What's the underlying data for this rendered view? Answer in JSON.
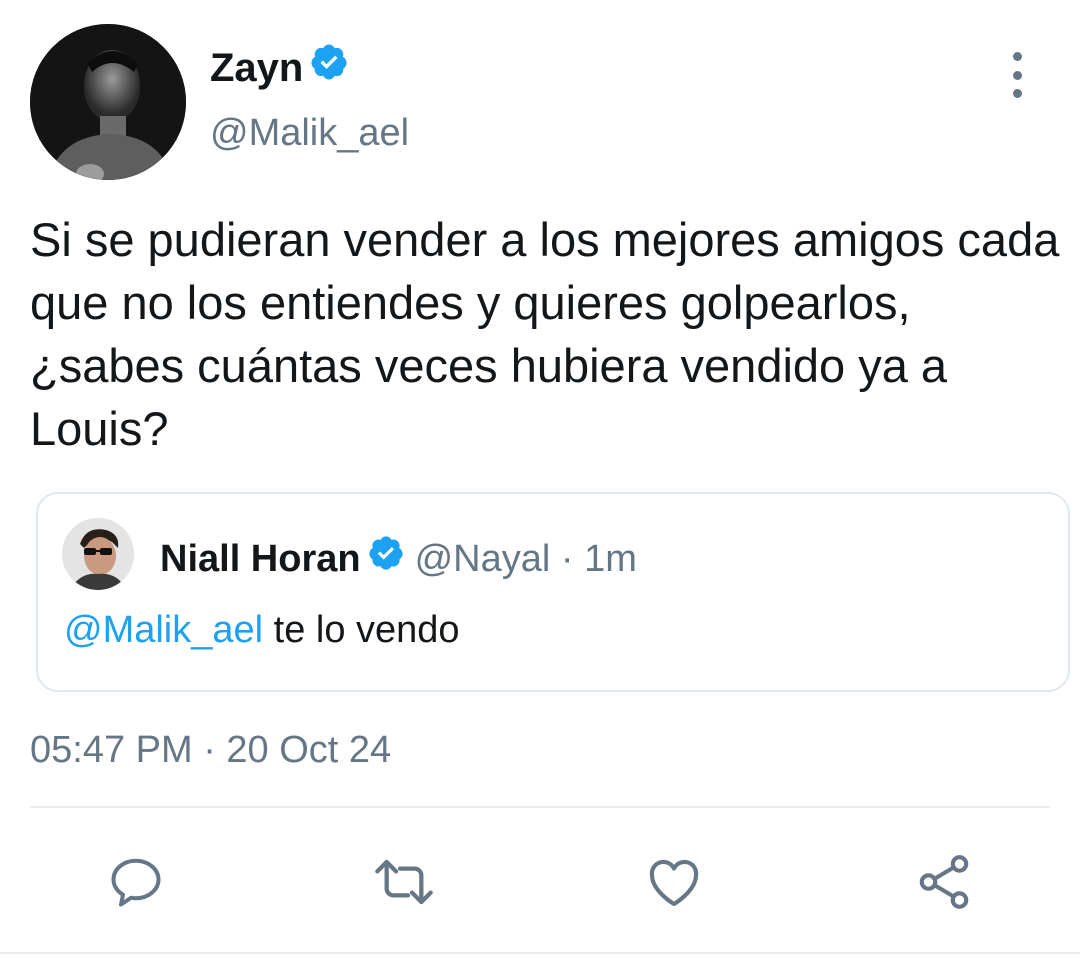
{
  "tweet": {
    "author": {
      "display_name": "Zayn",
      "handle": "@Malik_ael",
      "verified": true
    },
    "text": "Si se pudieran vender a los mejores amigos cada que no los entiendes y quieres golpearlos, ¿sabes cuántas veces hubiera vendido ya a Louis?",
    "timestamp": "05:47 PM · 20 Oct 24",
    "quoted": {
      "display_name": "Niall Horan",
      "handle_time": "@Nayal · 1m",
      "verified": true,
      "mention": "@Malik_ael",
      "text": " te lo vendo"
    }
  },
  "icons": {
    "more": "more-vertical-icon",
    "verified": "verified-badge-icon",
    "reply": "reply-icon",
    "retweet": "retweet-icon",
    "like": "like-icon",
    "share": "share-icon"
  },
  "colors": {
    "accent": "#1da1f2",
    "secondary_text": "#657786",
    "primary_text": "#14171a",
    "border": "#e1e8ed"
  }
}
